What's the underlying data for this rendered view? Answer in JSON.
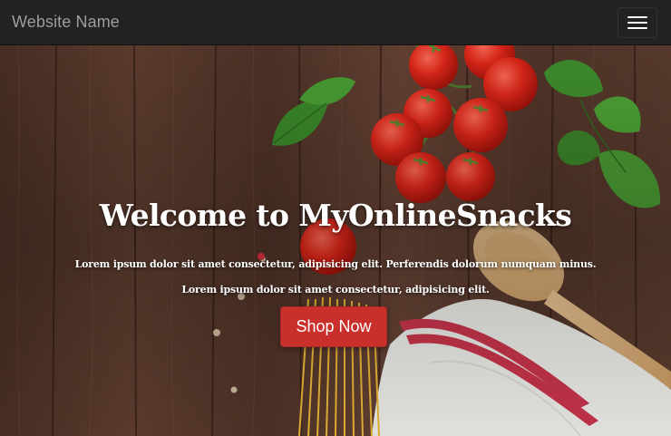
{
  "navbar": {
    "brand": "Website Name",
    "toggle_icon": "hamburger-menu-icon",
    "background": "#222222",
    "brand_color": "#9d9d9d"
  },
  "hero": {
    "title": "Welcome to MyOnlineSnacks",
    "text_line1": "Lorem ipsum dolor sit amet consectetur, adipisicing elit. Perferendis dolorum numquam minus.",
    "text_line2": "Lorem ipsum dolor sit amet consectetur, adipisicing elit.",
    "button_label": "Shop Now",
    "button_color": "#c9302c",
    "background_description_icon": "food-background-image"
  }
}
